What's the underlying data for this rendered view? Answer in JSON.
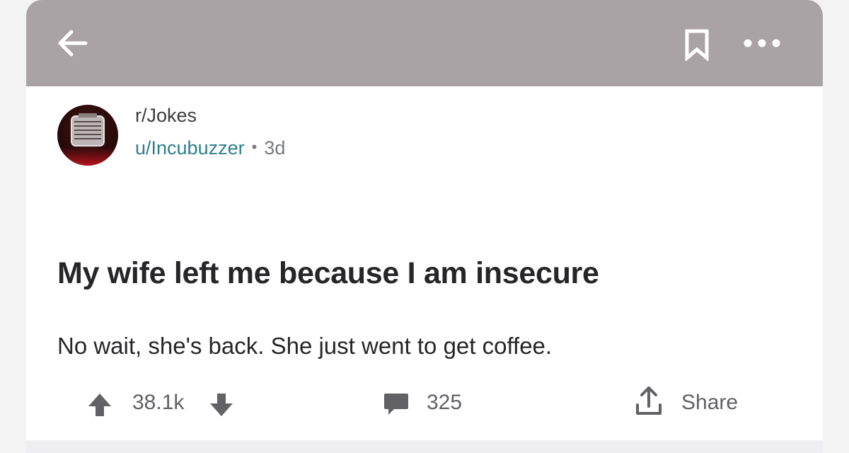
{
  "header": {
    "back_icon": "arrow-left-icon",
    "bookmark_icon": "bookmark-icon",
    "more_icon": "more-options-icon",
    "bar_color": "#aaa3a6"
  },
  "post": {
    "subreddit": "r/Jokes",
    "username": "u/Incubuzzer",
    "separator": "•",
    "age": "3d",
    "title": "My wife left me because I am insecure",
    "body": "No wait, she's back. She just went to get coffee."
  },
  "actions": {
    "score": "38.1k",
    "comment_count": "325",
    "share_label": "Share",
    "upvote_icon": "upvote-arrow-icon",
    "downvote_icon": "downvote-arrow-icon",
    "comment_icon": "comment-bubble-icon",
    "share_icon": "share-upload-icon"
  },
  "colors": {
    "username": "#2e7f8c",
    "text": "#262628",
    "muted": "#787c7e"
  }
}
